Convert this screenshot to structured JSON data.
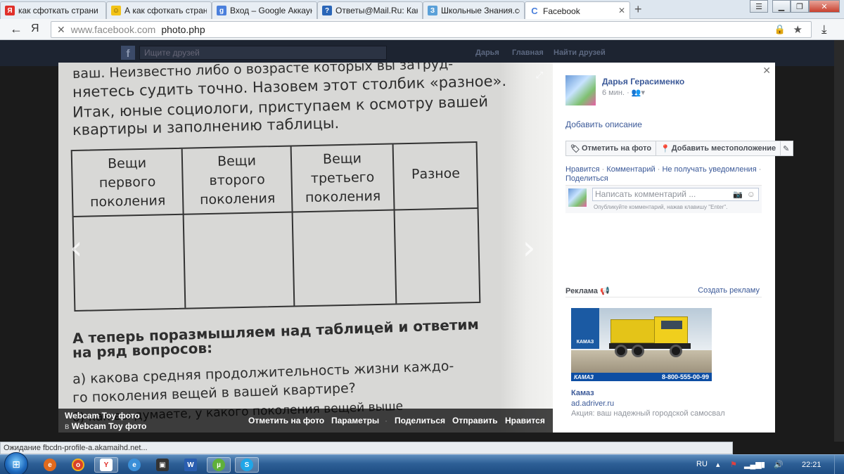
{
  "browser": {
    "tabs": [
      {
        "label": "как сфоткать страни",
        "favicon": "yandex-icon",
        "color": "#e0302a",
        "letter": "Я"
      },
      {
        "label": "А как сфоткать стран",
        "favicon": "smiley-icon",
        "color": "#f2c318",
        "letter": "☺"
      },
      {
        "label": "Вход – Google Аккаун",
        "favicon": "google-icon",
        "color": "#4a7fdc",
        "letter": "g"
      },
      {
        "label": "Ответы@Mail.Ru: Как",
        "favicon": "mailru-answers-icon",
        "color": "#2a66b8",
        "letter": "?"
      },
      {
        "label": "Школьные Знания.co",
        "favicon": "znanija-icon",
        "color": "#5aa0d8",
        "letter": "З"
      },
      {
        "label": "Facebook",
        "favicon": "loading-icon",
        "color": "#4a7fdc",
        "letter": "C",
        "active": true
      }
    ],
    "new_tab": "+",
    "yandex_button": "Я",
    "url_host": "www.facebook.com",
    "url_path": "photo.php",
    "status_text": "Ожидание fbcdn-profile-a.akamaihd.net..."
  },
  "fb_header": {
    "search_placeholder": "Ищите друзей",
    "nav": [
      "Дарья",
      "Главная",
      "Найти друзей"
    ]
  },
  "photo": {
    "text_lines": [
      "ваш. Неизвестно либо о возрасте которых вы затруд-",
      "няетесь судить точно. Назовем этот столбик «разное».",
      "Итак, юные социологи, приступаем к осмотру вашей",
      "квартиры и заполнению таблицы."
    ],
    "table_headers": [
      "Вещи\nпервого\nпоколения",
      "Вещи\nвторого\nпоколения",
      "Вещи\nтретьего\nпоколения",
      "Разное"
    ],
    "bottom_lines": [
      "А теперь поразмышляем над таблицей и ответим",
      "на ряд вопросов:",
      "а) какова средняя продолжительность жизни каждо-",
      "го поколения вещей в вашей квартире?",
      "б) как вы думаете, у какого поколения вещей выше"
    ],
    "prev_arrow": "‹",
    "next_arrow": "›",
    "album_title": "Webcam Toy фото",
    "album_prefix": "в",
    "album_link": "Webcam Toy фото",
    "actions": [
      "Отметить на фото",
      "Параметры",
      "Поделиться",
      "Отправить",
      "Нравится"
    ]
  },
  "panel": {
    "author": "Дарья Герасименко",
    "time": "6 мин. · 👥▾",
    "add_description": "Добавить описание",
    "tag_button": "Отметить на фото",
    "location_button": "Добавить местоположение",
    "like": "Нравится",
    "comment": "Комментарий",
    "unfollow": "Не получать уведомления",
    "share": "Поделиться",
    "comment_placeholder": "Написать комментарий ...",
    "comment_hint": "Опубликуйте комментарий, нажав клавишу \"Enter\".",
    "ads_title": "Реклама",
    "create_ad": "Создать рекламу",
    "ad_logo_text": "КАМАЗ",
    "ad_phone": "8-800-555-00-99",
    "ad_strip_brand": "КАМАЗ",
    "ad_name": "Камаз",
    "ad_url": "ad.adriver.ru",
    "ad_description": "Акция: ваш надежный городской самосвал"
  },
  "taskbar": {
    "language": "RU",
    "clock": "22:21"
  }
}
